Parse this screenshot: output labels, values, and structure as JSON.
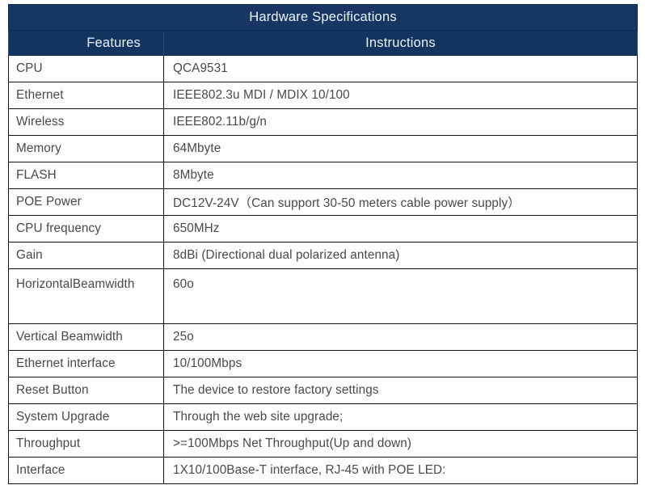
{
  "table": {
    "title": "Hardware Specifications",
    "columns": [
      {
        "key": "feature",
        "label": "Features"
      },
      {
        "key": "instruction",
        "label": "Instructions"
      }
    ],
    "rows": [
      {
        "feature": "CPU",
        "instruction": "QCA9531"
      },
      {
        "feature": "Ethernet",
        "instruction": "IEEE802.3u MDI / MDIX 10/100"
      },
      {
        "feature": "Wireless",
        "instruction": "IEEE802.11b/g/n"
      },
      {
        "feature": "Memory",
        "instruction": "64Mbyte"
      },
      {
        "feature": "FLASH",
        "instruction": "8Mbyte"
      },
      {
        "feature": "POE Power",
        "instruction": "DC12V-24V（Can support 30-50 meters cable power supply）"
      },
      {
        "feature": "CPU frequency",
        "instruction": "650MHz"
      },
      {
        "feature": "Gain",
        "instruction": "8dBi (Directional dual polarized antenna)"
      },
      {
        "feature": "HorizontalBeamwidth",
        "instruction": "60o"
      },
      {
        "feature": "Vertical Beamwidth",
        "instruction": "25o"
      },
      {
        "feature": "Ethernet interface",
        "instruction": "10/100Mbps"
      },
      {
        "feature": "Reset Button",
        "instruction": "The device to restore factory settings"
      },
      {
        "feature": "System Upgrade",
        "instruction": "Through the web site upgrade;"
      },
      {
        "feature": "Throughput",
        "instruction": ">=100Mbps Net Throughput(Up and down)"
      },
      {
        "feature": "Interface",
        "instruction": "1X10/100Base-T interface, RJ-45 with POE LED:"
      }
    ]
  },
  "colors": {
    "header_blue": "#173664",
    "header_row_blue": "#143460",
    "header_text": "#eaf2fb",
    "cell_text": "#4a4a4a",
    "cell_background": "#fdfdfd",
    "border": "#121212"
  }
}
